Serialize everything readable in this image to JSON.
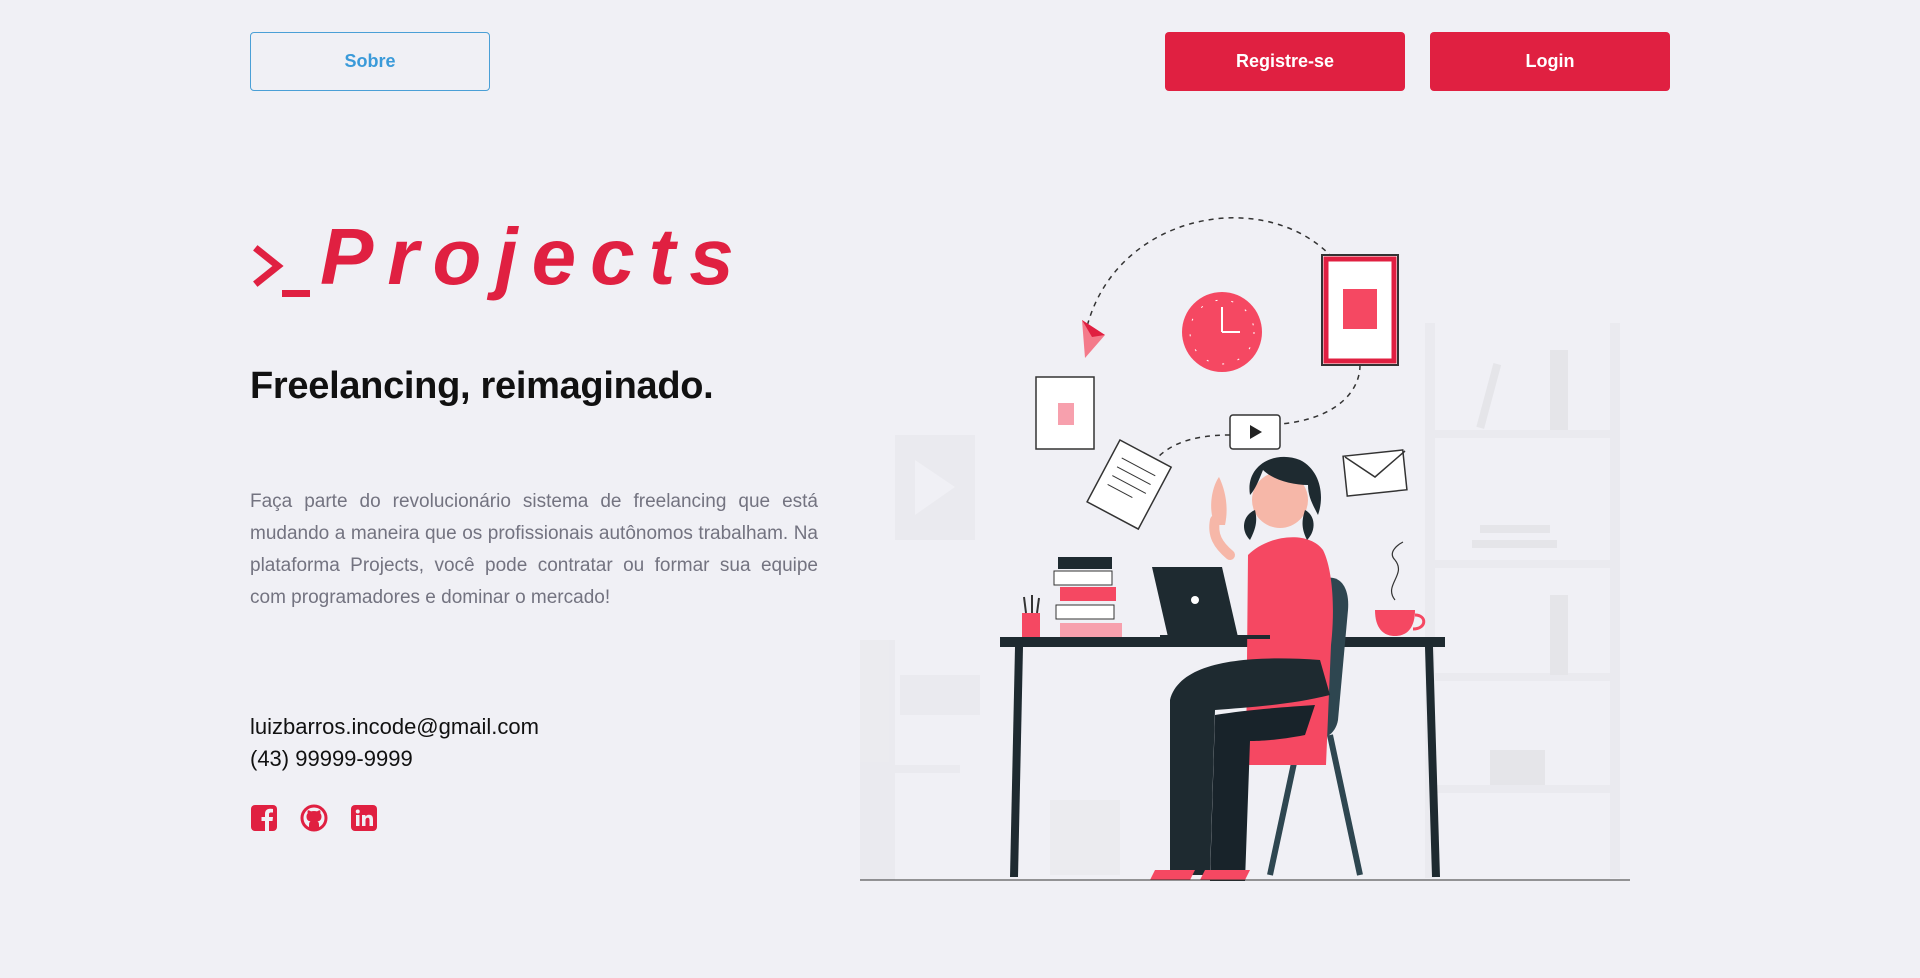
{
  "header": {
    "about_label": "Sobre",
    "register_label": "Registre-se",
    "login_label": "Login"
  },
  "hero": {
    "logo_text": "Projects",
    "tagline": "Freelancing, reimaginado.",
    "description": "Faça parte do revolucionário sistema de freelancing que está mudando a maneira que os profissionais autônomos trabalham. Na plataforma Projects, você pode contratar ou formar sua equipe com programadores e dominar o mercado!"
  },
  "contact": {
    "email": "luizbarros.incode@gmail.com",
    "phone": "(43) 99999-9999"
  },
  "socials": [
    {
      "icon": "facebook-icon"
    },
    {
      "icon": "github-icon"
    },
    {
      "icon": "linkedin-icon"
    }
  ],
  "colors": {
    "brand_red": "#e02041",
    "accent_blue": "#3a9ad9",
    "background": "#f0f0f5",
    "text_muted": "#737380"
  }
}
